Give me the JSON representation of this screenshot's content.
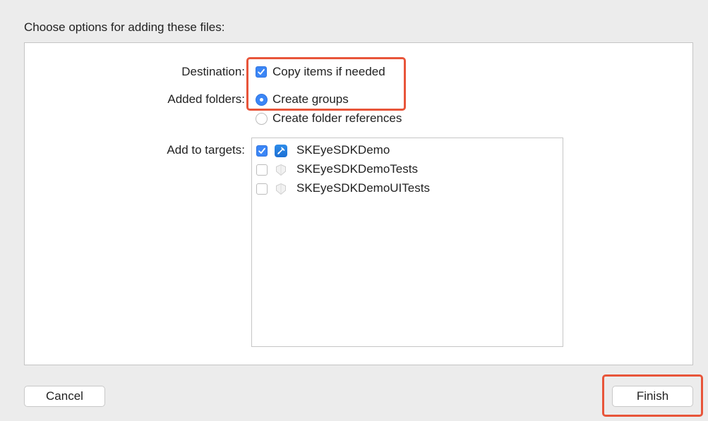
{
  "dialog": {
    "heading": "Choose options for adding these files:"
  },
  "destination": {
    "label": "Destination:",
    "option": "Copy items if needed",
    "checked": true
  },
  "added_folders": {
    "label": "Added folders:",
    "options": [
      {
        "label": "Create groups",
        "selected": true
      },
      {
        "label": "Create folder references",
        "selected": false
      }
    ]
  },
  "targets": {
    "label": "Add to targets:",
    "items": [
      {
        "name": "SKEyeSDKDemo",
        "checked": true,
        "icon": "app-target-icon"
      },
      {
        "name": "SKEyeSDKDemoTests",
        "checked": false,
        "icon": "test-target-icon"
      },
      {
        "name": "SKEyeSDKDemoUITests",
        "checked": false,
        "icon": "test-target-icon"
      }
    ]
  },
  "buttons": {
    "cancel": "Cancel",
    "finish": "Finish"
  },
  "colors": {
    "accent": "#3b86f6",
    "highlight": "#e8553a"
  }
}
